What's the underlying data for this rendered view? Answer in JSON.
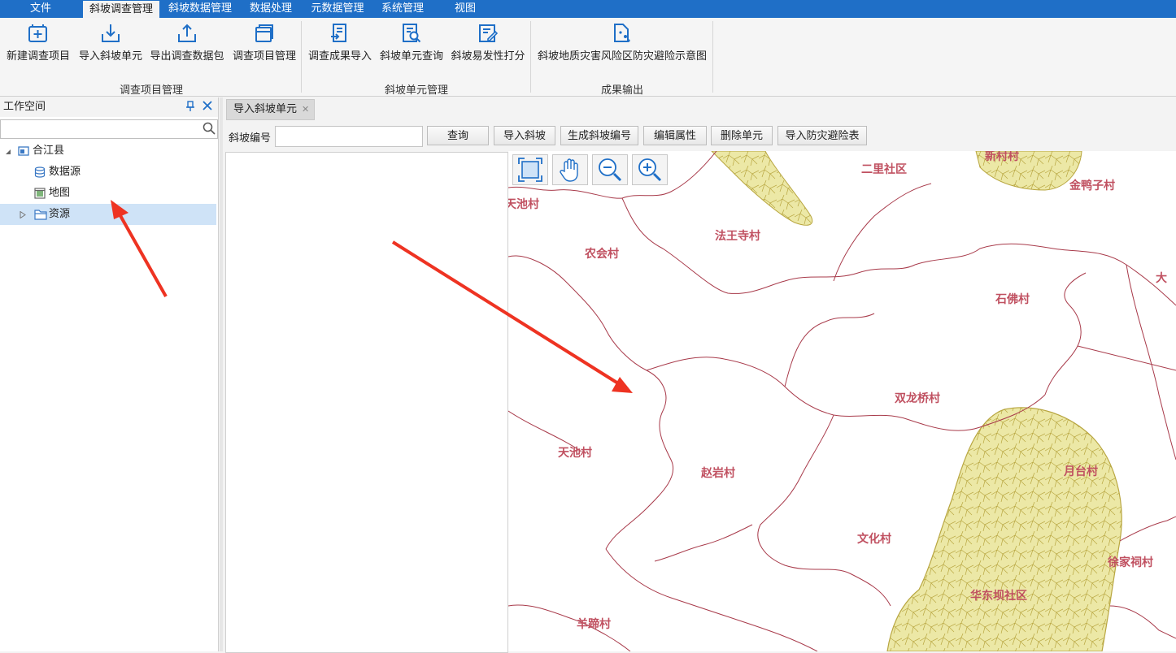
{
  "menubar": {
    "tabs": [
      "文件",
      "斜坡调查管理",
      "斜坡数据管理",
      "数据处理",
      "元数据管理",
      "系统管理",
      "视图"
    ],
    "active_index": 1,
    "color": "#1f6fc7"
  },
  "ribbon": {
    "buttons": [
      {
        "label": "新建调查项目",
        "icon": "new-project-icon"
      },
      {
        "label": "导入斜坡单元",
        "icon": "import-slope-icon"
      },
      {
        "label": "导出调查数据包",
        "icon": "export-package-icon"
      },
      {
        "label": "调查项目管理",
        "icon": "project-manage-icon"
      },
      {
        "label": "调查成果导入",
        "icon": "result-import-icon"
      },
      {
        "label": "斜坡单元查询",
        "icon": "slope-query-icon"
      },
      {
        "label": "斜坡易发性打分",
        "icon": "susceptibility-score-icon"
      },
      {
        "label": "斜坡地质灾害风险区防灾避险示意图",
        "icon": "risk-map-icon"
      }
    ],
    "groups": [
      "调查项目管理",
      "斜坡单元管理",
      "成果输出"
    ]
  },
  "workspace": {
    "title": "工作空间",
    "search_placeholder": "",
    "tree": [
      {
        "label": "合江县",
        "icon": "county-icon"
      },
      {
        "label": "数据源",
        "icon": "datasource-icon"
      },
      {
        "label": "地图",
        "icon": "map-icon"
      },
      {
        "label": "资源",
        "icon": "folder-icon",
        "selected": true
      }
    ]
  },
  "document": {
    "tab_label": "导入斜坡单元",
    "toolbar": {
      "slope_id_label": "斜坡编号",
      "slope_id_value": "",
      "buttons": [
        "查询",
        "导入斜坡",
        "生成斜坡编号",
        "编辑属性",
        "删除单元",
        "导入防灾避险表"
      ]
    }
  },
  "map": {
    "tools": [
      {
        "name": "full-extent",
        "icon": "full-extent-icon"
      },
      {
        "name": "pan",
        "icon": "hand-pan-icon"
      },
      {
        "name": "zoom-out",
        "icon": "zoom-out-icon"
      },
      {
        "name": "zoom-in",
        "icon": "zoom-in-icon"
      }
    ],
    "villages": [
      "二里社区",
      "新村村",
      "金鸭子村",
      "天池村",
      "法王寺村",
      "农会村",
      "石佛村",
      "大",
      "双龙桥村",
      "天池村",
      "赵岩村",
      "月台村",
      "文化村",
      "徐家祠村",
      "华东坝社区",
      "羊蹄村"
    ],
    "boundary_color": "#a83a4a",
    "label_color": "#c05060",
    "polygon_fill": "#ece8a6",
    "polygon_stroke": "#b8a640"
  },
  "annotation_color": "#ee3322"
}
